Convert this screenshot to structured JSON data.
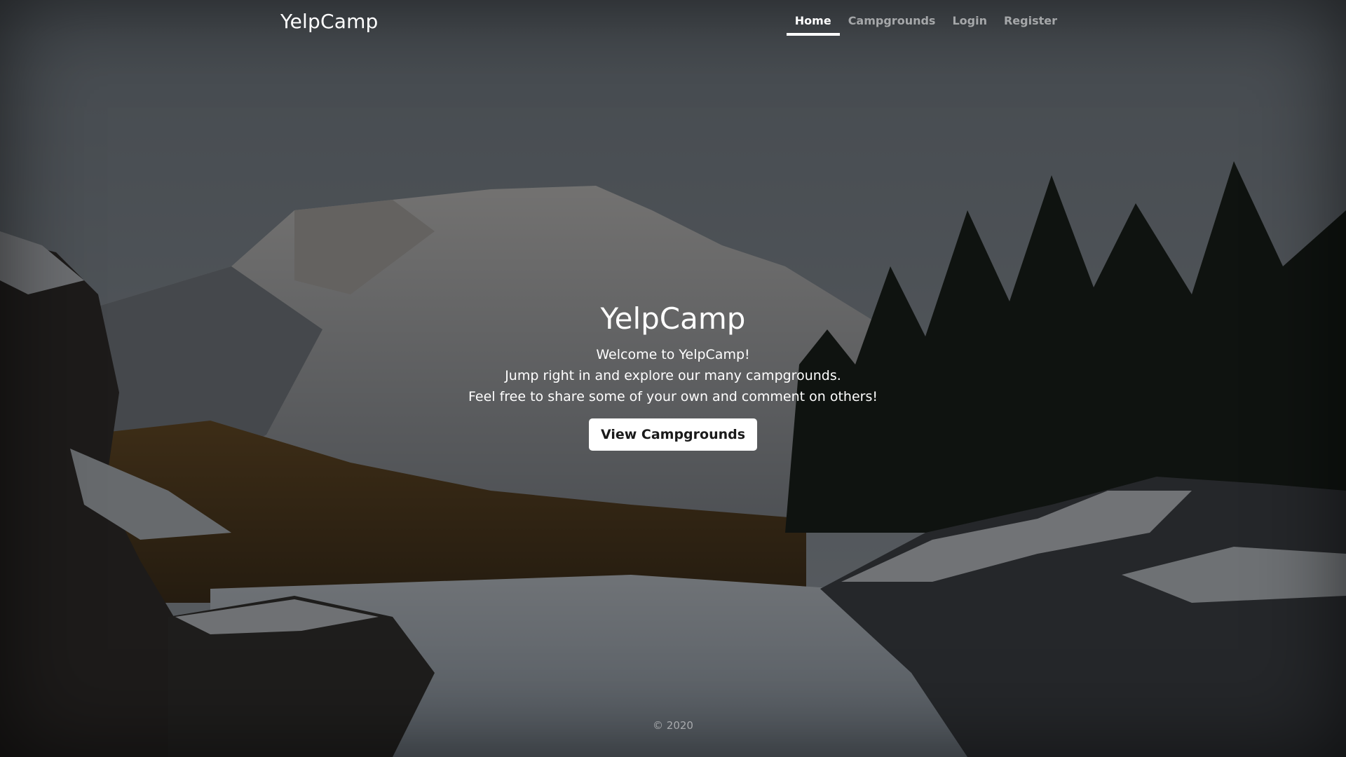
{
  "header": {
    "brand": "YelpCamp",
    "nav": [
      {
        "label": "Home",
        "active": true
      },
      {
        "label": "Campgrounds",
        "active": false
      },
      {
        "label": "Login",
        "active": false
      },
      {
        "label": "Register",
        "active": false
      }
    ]
  },
  "hero": {
    "title": "YelpCamp",
    "lines": [
      "Welcome to YelpCamp!",
      "Jump right in and explore our many campgrounds.",
      "Feel free to share some of your own and comment on others!"
    ],
    "button_label": "View Campgrounds"
  },
  "footer": {
    "copyright": "© 2020"
  },
  "colors": {
    "overlay": "#000000",
    "text": "#ffffff",
    "button_bg": "#ffffff",
    "button_text": "#1a1a1a"
  },
  "background": {
    "icon": "snowy-mountain-landscape-image"
  }
}
